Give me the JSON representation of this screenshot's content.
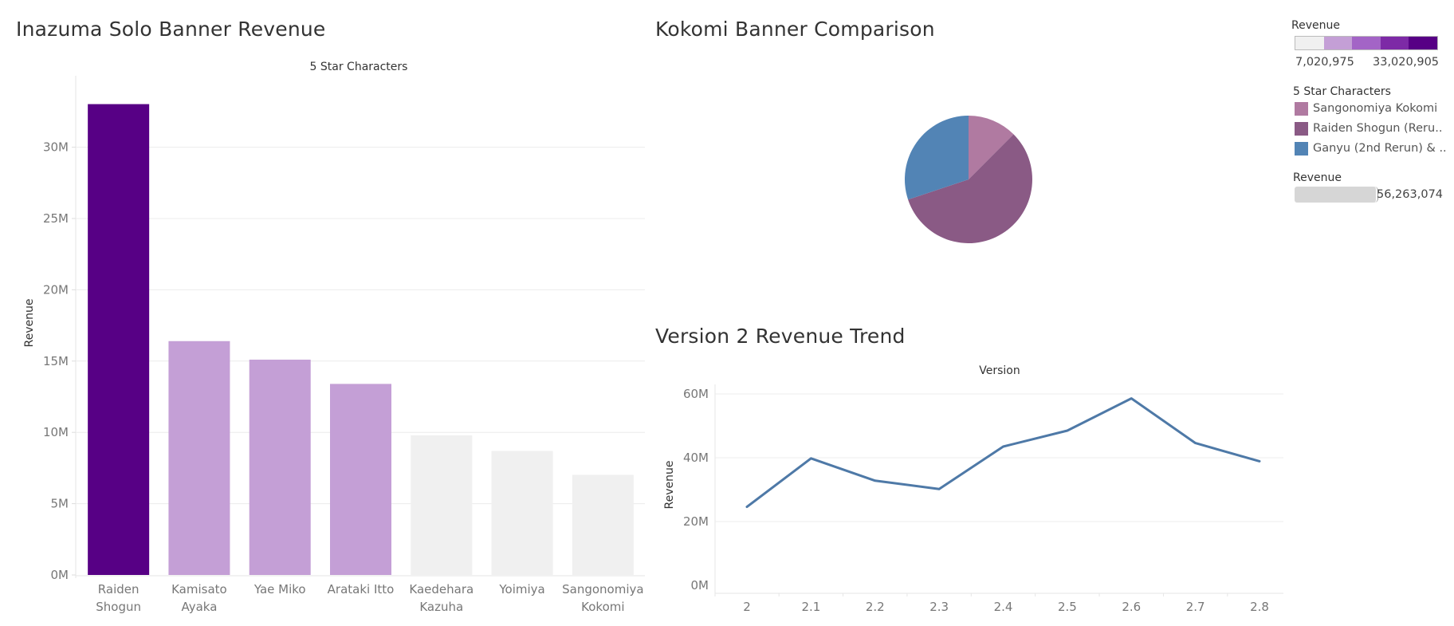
{
  "panels": {
    "bar_title": "Inazuma Solo Banner Revenue",
    "pie_title": "Kokomi Banner Comparison",
    "line_title": "Version 2 Revenue Trend"
  },
  "colors": {
    "bar_top": "#570085",
    "bar_mid": "#c49fd6",
    "bar_low": "#f0f0f0",
    "line": "#4e79a7",
    "pie_kokomi": "#b07aa1",
    "pie_raiden": "#8a5a85",
    "pie_ganyu": "#5284b5"
  },
  "legends": {
    "revenue_color": {
      "title": "Revenue",
      "min_label": "7,020,975",
      "max_label": "33,020,905",
      "swatches": [
        "#f0f0f0",
        "#c49fd6",
        "#a364c6",
        "#7d2aa6",
        "#570085"
      ]
    },
    "characters": {
      "title": "5 Star Characters",
      "items": [
        {
          "label": "Sangonomiya Kokomi",
          "color": "#b07aa1"
        },
        {
          "label": "Raiden Shogun (Reru..",
          "color": "#8a5a85"
        },
        {
          "label": "Ganyu (2nd Rerun) & ..",
          "color": "#5284b5"
        }
      ]
    },
    "revenue_size": {
      "title": "Revenue",
      "max_label": "56,263,074"
    }
  },
  "chart_data": [
    {
      "type": "bar",
      "title": "Inazuma Solo Banner Revenue",
      "column_header": "5 Star Characters",
      "ylabel": "Revenue",
      "ylim": [
        0,
        33500000
      ],
      "yticks": [
        0,
        5000000,
        10000000,
        15000000,
        20000000,
        25000000,
        30000000
      ],
      "ytick_labels": [
        "0M",
        "5M",
        "10M",
        "15M",
        "20M",
        "25M",
        "30M"
      ],
      "categories": [
        "Raiden Shogun",
        "Kamisato Ayaka",
        "Yae Miko",
        "Arataki Itto",
        "Kaedehara Kazuha",
        "Yoimiya",
        "Sangonomiya Kokomi"
      ],
      "category_lines": [
        [
          "Raiden",
          "Shogun"
        ],
        [
          "Kamisato",
          "Ayaka"
        ],
        [
          "Yae Miko"
        ],
        [
          "Arataki Itto"
        ],
        [
          "Kaedehara",
          "Kazuha"
        ],
        [
          "Yoimiya"
        ],
        [
          "Sangonomiya",
          "Kokomi"
        ]
      ],
      "values": [
        33020905,
        16400000,
        15100000,
        13400000,
        9800000,
        8700000,
        7020975
      ],
      "grid": true
    },
    {
      "type": "pie",
      "title": "Kokomi Banner Comparison",
      "labels": [
        "Sangonomiya Kokomi",
        "Raiden Shogun (Rerun)",
        "Ganyu (2nd Rerun)"
      ],
      "values": [
        7020975,
        32300000,
        16942099
      ]
    },
    {
      "type": "line",
      "title": "Version 2 Revenue Trend",
      "column_header": "Version",
      "ylabel": "Revenue",
      "x": [
        "2",
        "2.1",
        "2.2",
        "2.3",
        "2.4",
        "2.5",
        "2.6",
        "2.7",
        "2.8"
      ],
      "values": [
        24600000,
        39800000,
        32800000,
        30200000,
        43500000,
        48500000,
        58600000,
        44600000,
        38900000
      ],
      "ylim": [
        -2500000,
        62500000
      ],
      "yticks": [
        0,
        20000000,
        40000000,
        60000000
      ],
      "ytick_labels": [
        "0M",
        "20M",
        "40M",
        "60M"
      ],
      "grid": true
    }
  ]
}
